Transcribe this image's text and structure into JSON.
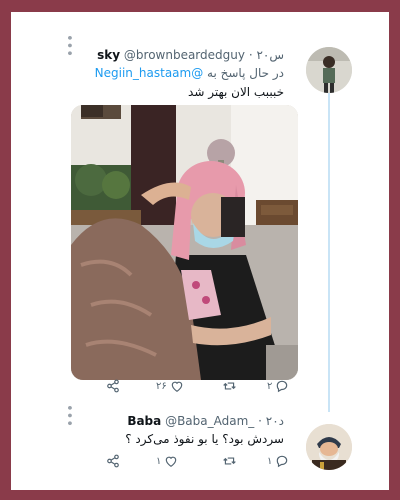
{
  "tweet1": {
    "name": "sky",
    "handle": "@brownbeardedguy",
    "time": "۲۰س",
    "reply_prefix": "در حال پاسخ به",
    "reply_to": "@Negiin_hastaam",
    "text": "خبببب الان بهتر شد",
    "reply_count": "۲",
    "retweet_count": "",
    "like_count": "۲۶"
  },
  "tweet2": {
    "name": "Baba",
    "handle": "@Baba_Adam_",
    "time": "۲۰د",
    "text": "سردش بود؟ یا بو نفوذ می‌کرد ؟",
    "reply_count": "۱",
    "retweet_count": "",
    "like_count": "۱"
  },
  "icons": {
    "reply": "reply-icon",
    "retweet": "retweet-icon",
    "like": "heart-icon",
    "share": "share-icon",
    "more": "more-icon"
  },
  "colors": {
    "background": "#8a3b4a",
    "accent": "#1d9bf0",
    "thread_line": "#c9e4f6"
  }
}
